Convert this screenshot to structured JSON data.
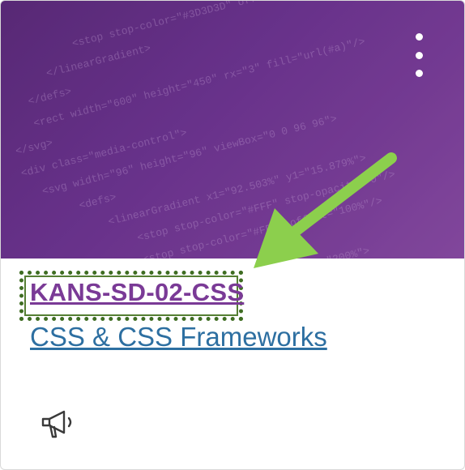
{
  "card": {
    "course_code": "KANS-SD-02-CSS",
    "course_name": "CSS & CSS Frameworks",
    "image_theme_color": "#6c3490",
    "menu_icon": "kebab-menu-icon",
    "announcement_icon": "megaphone-icon",
    "highlight_color": "#3f6d22",
    "arrow_color": "#8ccf4d"
  }
}
